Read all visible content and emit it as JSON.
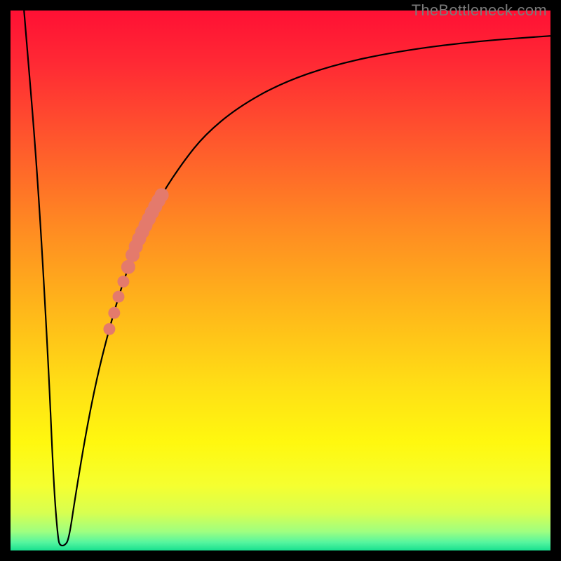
{
  "watermark": "TheBottleneck.com",
  "colors": {
    "frame": "#000000",
    "curve_stroke": "#000000",
    "marker_fill": "#e47a6c",
    "gradient_stops": [
      {
        "offset": 0.0,
        "color": "#ff1034"
      },
      {
        "offset": 0.1,
        "color": "#ff2a34"
      },
      {
        "offset": 0.25,
        "color": "#ff5a2c"
      },
      {
        "offset": 0.4,
        "color": "#ff8a22"
      },
      {
        "offset": 0.55,
        "color": "#ffb61a"
      },
      {
        "offset": 0.7,
        "color": "#ffe015"
      },
      {
        "offset": 0.8,
        "color": "#fff80f"
      },
      {
        "offset": 0.88,
        "color": "#f5ff30"
      },
      {
        "offset": 0.93,
        "color": "#d8ff50"
      },
      {
        "offset": 0.965,
        "color": "#9fff80"
      },
      {
        "offset": 0.985,
        "color": "#55f59f"
      },
      {
        "offset": 1.0,
        "color": "#18e08f"
      }
    ]
  },
  "chart_data": {
    "type": "line",
    "title": "",
    "xlabel": "",
    "ylabel": "",
    "xlim": [
      0,
      100
    ],
    "ylim": [
      0,
      100
    ],
    "grid": false,
    "curve": [
      {
        "x": 2.5,
        "y": 100
      },
      {
        "x": 5.0,
        "y": 70
      },
      {
        "x": 7.0,
        "y": 35
      },
      {
        "x": 8.0,
        "y": 12
      },
      {
        "x": 8.8,
        "y": 2
      },
      {
        "x": 9.2,
        "y": 0.9
      },
      {
        "x": 10.0,
        "y": 0.9
      },
      {
        "x": 10.8,
        "y": 2
      },
      {
        "x": 12.0,
        "y": 10
      },
      {
        "x": 14.0,
        "y": 22
      },
      {
        "x": 16.0,
        "y": 32
      },
      {
        "x": 18.0,
        "y": 40
      },
      {
        "x": 20.0,
        "y": 47
      },
      {
        "x": 22.0,
        "y": 53
      },
      {
        "x": 25.0,
        "y": 60
      },
      {
        "x": 28.0,
        "y": 66
      },
      {
        "x": 32.0,
        "y": 72
      },
      {
        "x": 36.0,
        "y": 77
      },
      {
        "x": 42.0,
        "y": 82
      },
      {
        "x": 50.0,
        "y": 86.5
      },
      {
        "x": 60.0,
        "y": 90
      },
      {
        "x": 72.0,
        "y": 92.5
      },
      {
        "x": 86.0,
        "y": 94.3
      },
      {
        "x": 100.0,
        "y": 95.3
      }
    ],
    "markers": [
      {
        "x": 18.3,
        "y": 41.0,
        "r": 1.1
      },
      {
        "x": 19.2,
        "y": 44.0,
        "r": 1.1
      },
      {
        "x": 20.0,
        "y": 47.0,
        "r": 1.1
      },
      {
        "x": 20.9,
        "y": 49.8,
        "r": 1.1
      },
      {
        "x": 21.8,
        "y": 52.5,
        "r": 1.3
      },
      {
        "x": 22.6,
        "y": 54.7,
        "r": 1.3
      },
      {
        "x": 23.2,
        "y": 56.3,
        "r": 1.3
      },
      {
        "x": 23.8,
        "y": 57.7,
        "r": 1.3
      },
      {
        "x": 24.4,
        "y": 59.0,
        "r": 1.3
      },
      {
        "x": 25.0,
        "y": 60.2,
        "r": 1.3
      },
      {
        "x": 25.6,
        "y": 61.4,
        "r": 1.3
      },
      {
        "x": 26.2,
        "y": 62.6,
        "r": 1.3
      },
      {
        "x": 26.8,
        "y": 63.7,
        "r": 1.3
      },
      {
        "x": 27.4,
        "y": 64.8,
        "r": 1.3
      },
      {
        "x": 28.0,
        "y": 65.8,
        "r": 1.3
      }
    ]
  }
}
